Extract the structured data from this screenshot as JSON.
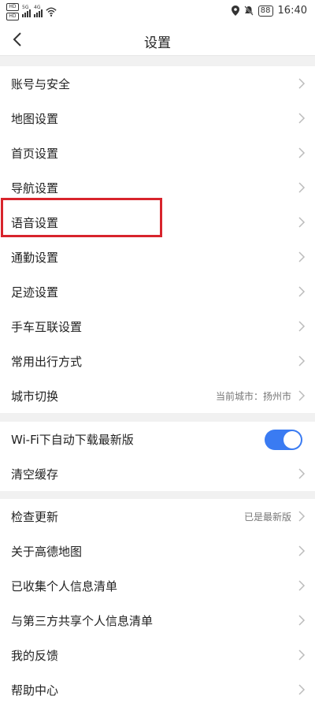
{
  "status_bar": {
    "sim1": "HD",
    "sim2": "HD",
    "net1": "5G",
    "net2": "4G",
    "battery": "88",
    "time": "16:40"
  },
  "header": {
    "title": "设置",
    "back_icon": "chevron-left-icon"
  },
  "group1": [
    {
      "label": "账号与安全"
    },
    {
      "label": "地图设置"
    },
    {
      "label": "首页设置"
    },
    {
      "label": "导航设置"
    },
    {
      "label": "语音设置",
      "highlighted": true
    },
    {
      "label": "通勤设置"
    },
    {
      "label": "足迹设置"
    },
    {
      "label": "手车互联设置"
    },
    {
      "label": "常用出行方式"
    },
    {
      "label": "城市切换",
      "value": "当前城市：扬州市"
    }
  ],
  "group2": [
    {
      "label": "Wi-Fi下自动下载最新版",
      "toggle_on": true
    },
    {
      "label": "清空缓存"
    }
  ],
  "group3": [
    {
      "label": "检查更新",
      "value": "已是最新版"
    },
    {
      "label": "关于高德地图"
    },
    {
      "label": "已收集个人信息清单"
    },
    {
      "label": "与第三方共享个人信息清单"
    },
    {
      "label": "我的反馈"
    },
    {
      "label": "帮助中心"
    }
  ],
  "colors": {
    "accent": "#3a7bf2",
    "highlight_box": "#d8242c"
  }
}
